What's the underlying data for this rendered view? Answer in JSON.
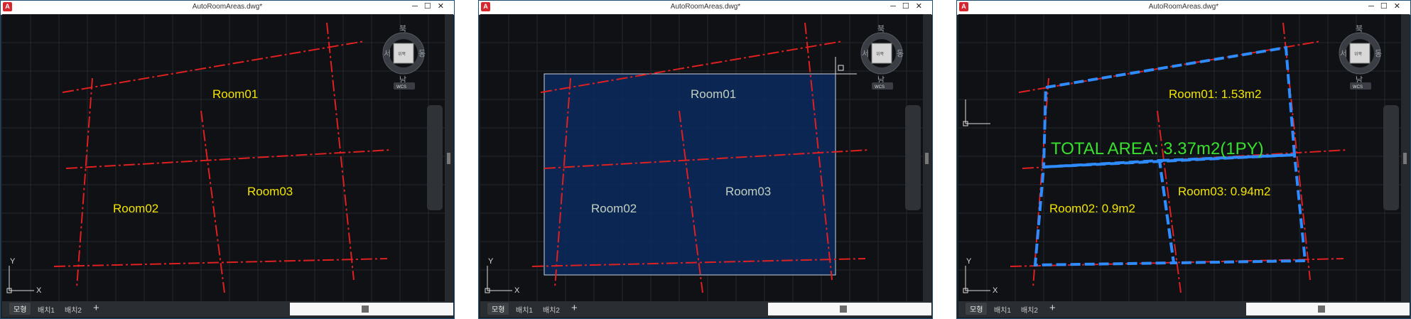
{
  "windows": [
    {
      "title": "AutoRoomAreas.dwg*",
      "app_icon": "A",
      "compass": {
        "north": "북",
        "south": "남",
        "west": "서",
        "east": "동",
        "cube_face": "위쪽"
      },
      "ucs_label": "WCS",
      "axis": {
        "x": "X",
        "y": "Y"
      },
      "rooms": [
        "Room01",
        "Room02",
        "Room03"
      ],
      "tabs": {
        "model": "모형",
        "layout1": "배치1",
        "layout2": "배치2",
        "add": "+"
      }
    },
    {
      "title": "AutoRoomAreas.dwg*",
      "app_icon": "A",
      "compass": {
        "north": "북",
        "south": "남",
        "west": "서",
        "east": "동",
        "cube_face": "위쪽"
      },
      "ucs_label": "WCS",
      "axis": {
        "x": "X",
        "y": "Y"
      },
      "rooms": [
        "Room01",
        "Room02",
        "Room03"
      ],
      "tabs": {
        "model": "모형",
        "layout1": "배치1",
        "layout2": "배치2",
        "add": "+"
      }
    },
    {
      "title": "AutoRoomAreas.dwg*",
      "app_icon": "A",
      "compass": {
        "north": "북",
        "south": "남",
        "west": "서",
        "east": "동",
        "cube_face": "위쪽"
      },
      "ucs_label": "WCS",
      "axis": {
        "x": "X",
        "y": "Y"
      },
      "rooms": [
        "Room01: 1.53m2",
        "Room02: 0.9m2",
        "Room03: 0.94m2"
      ],
      "total_area": "TOTAL AREA: 3.37m2(1PY)",
      "tabs": {
        "model": "모형",
        "layout1": "배치1",
        "layout2": "배치2",
        "add": "+"
      }
    }
  ],
  "colors": {
    "background": "#0f1115",
    "centerline": "#e02020",
    "room_label": "#f2e400",
    "boundary": "#2e8cff",
    "selection_fill": "#0b2a5e",
    "total_label": "#38e02e"
  }
}
